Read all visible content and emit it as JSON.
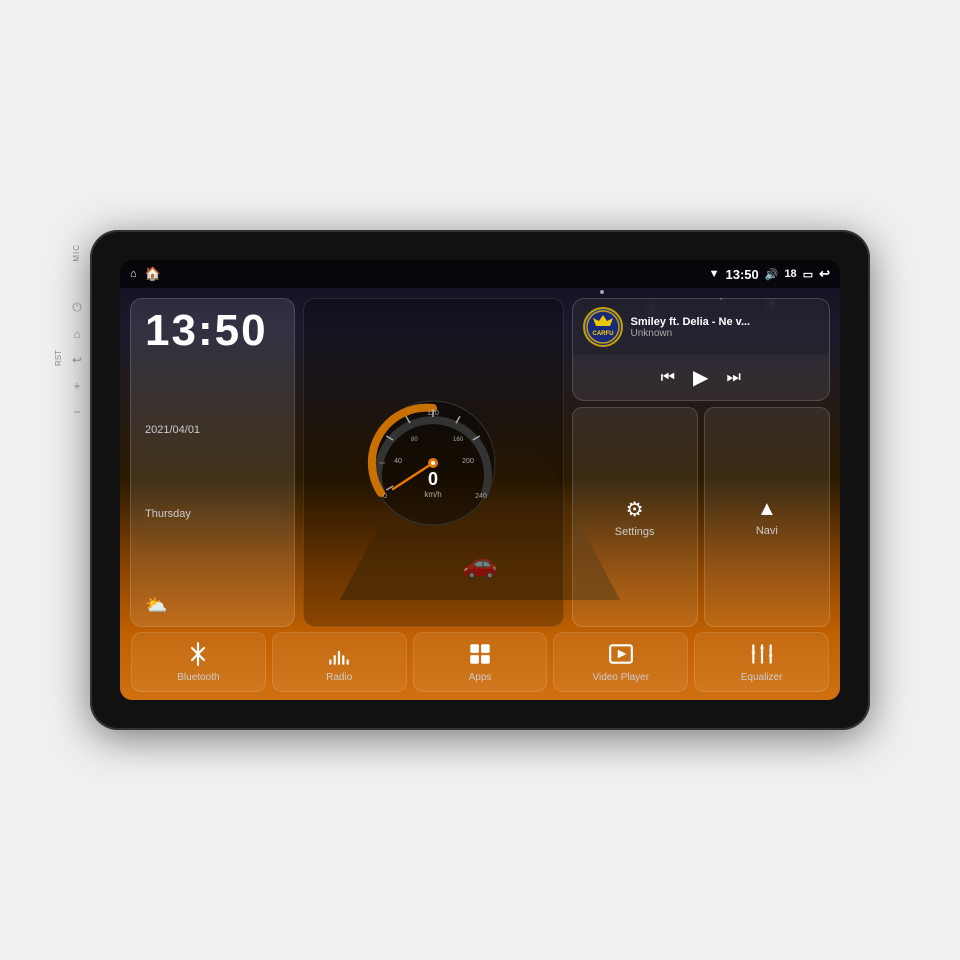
{
  "device": {
    "mic_label": "MIC",
    "rst_label": "RST"
  },
  "status_bar": {
    "home_icon": "⌂",
    "house_icon": "🏠",
    "time": "13:50",
    "wifi_icon": "▼",
    "volume_icon": "🔊",
    "volume_level": "18",
    "battery_icon": "▭",
    "back_icon": "↩"
  },
  "clock_widget": {
    "time": "13:50",
    "date": "2021/04/01",
    "day": "Thursday",
    "weather_icon": "☁"
  },
  "music_widget": {
    "logo_text": "CARFU",
    "title": "Smiley ft. Delia - Ne v...",
    "artist": "Unknown",
    "prev_icon": "⏮",
    "play_icon": "▶",
    "next_icon": "⏭"
  },
  "settings_btn": {
    "icon": "⚙",
    "label": "Settings"
  },
  "navi_btn": {
    "label": "Navi"
  },
  "app_bar": {
    "items": [
      {
        "id": "bluetooth",
        "icon": "bluetooth",
        "label": "Bluetooth"
      },
      {
        "id": "radio",
        "icon": "radio",
        "label": "Radio"
      },
      {
        "id": "apps",
        "icon": "apps",
        "label": "Apps"
      },
      {
        "id": "video",
        "icon": "video",
        "label": "Video Player"
      },
      {
        "id": "equalizer",
        "icon": "equalizer",
        "label": "Equalizer"
      }
    ]
  },
  "speedo": {
    "speed": "0",
    "unit": "km/h",
    "max": "240"
  }
}
